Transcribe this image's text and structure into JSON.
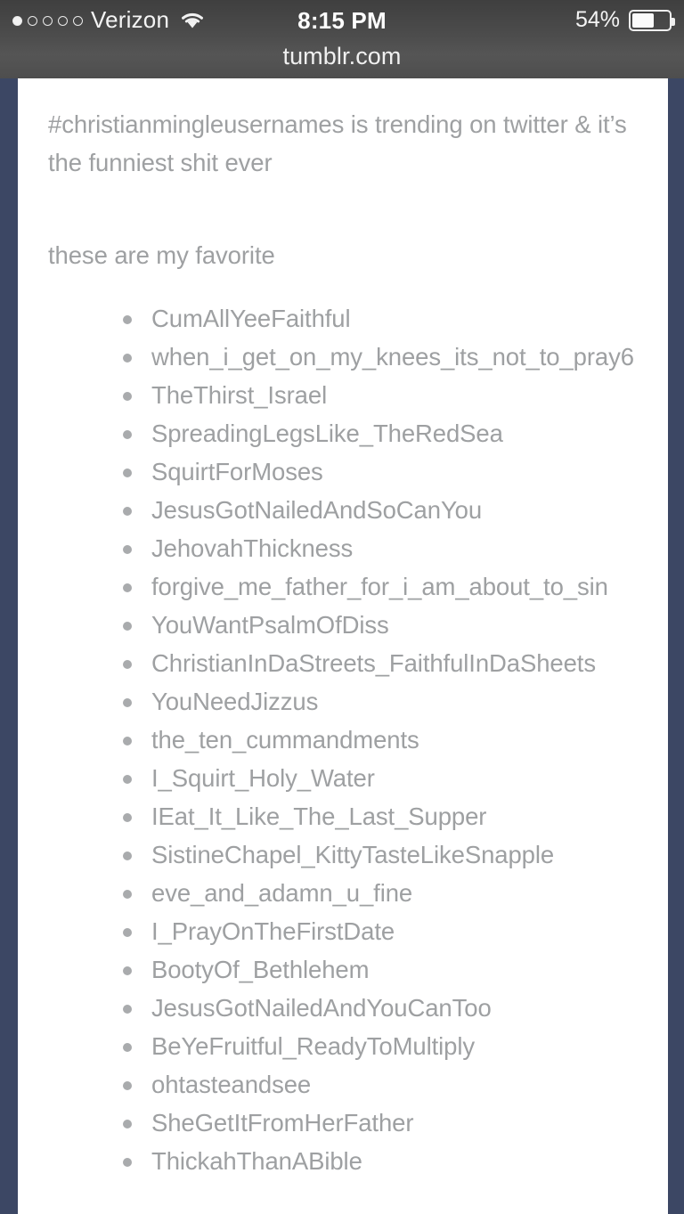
{
  "status_bar": {
    "signal": {
      "icon": "signal-dots-icon",
      "total_dots": 5,
      "filled_dots": 1
    },
    "carrier": "Verizon",
    "wifi_icon": "wifi-icon",
    "time": "8:15 PM",
    "battery_percent": "54%",
    "battery_level": 54,
    "battery_icon": "battery-icon"
  },
  "browser": {
    "url": "tumblr.com"
  },
  "colors": {
    "page_background": "#3c4764",
    "card_background": "#ffffff",
    "body_text": "#9ea0a2",
    "chrome_background": "#4c4c4c",
    "status_text": "#ffffff"
  },
  "post": {
    "paragraphs": [
      "#christianmingleusernames is trending on twitter & it’s the funniest shit ever",
      "these are my favorite"
    ],
    "usernames": [
      "CumAllYeeFaithful",
      "when_i_get_on_my_knees_its_not_to_pray6",
      "TheThirst_Israel",
      "SpreadingLegsLike_TheRedSea",
      "SquirtForMoses",
      "JesusGotNailedAndSoCanYou",
      "JehovahThickness",
      "forgive_me_father_for_i_am_about_to_sin",
      "YouWantPsalmOfDiss",
      "ChristianInDaStreets_FaithfulInDaSheets",
      "YouNeedJizzus",
      "the_ten_cummandments",
      "I_Squirt_Holy_Water",
      "IEat_It_Like_The_Last_Supper",
      "SistineChapel_KittyTasteLikeSnapple",
      "eve_and_adamn_u_fine",
      "I_PrayOnTheFirstDate",
      "BootyOf_Bethlehem",
      "JesusGotNailedAndYouCanToo",
      "BeYeFruitful_ReadyToMultiply",
      "ohtasteandsee",
      "SheGetItFromHerFather",
      "ThickahThanABible"
    ]
  }
}
